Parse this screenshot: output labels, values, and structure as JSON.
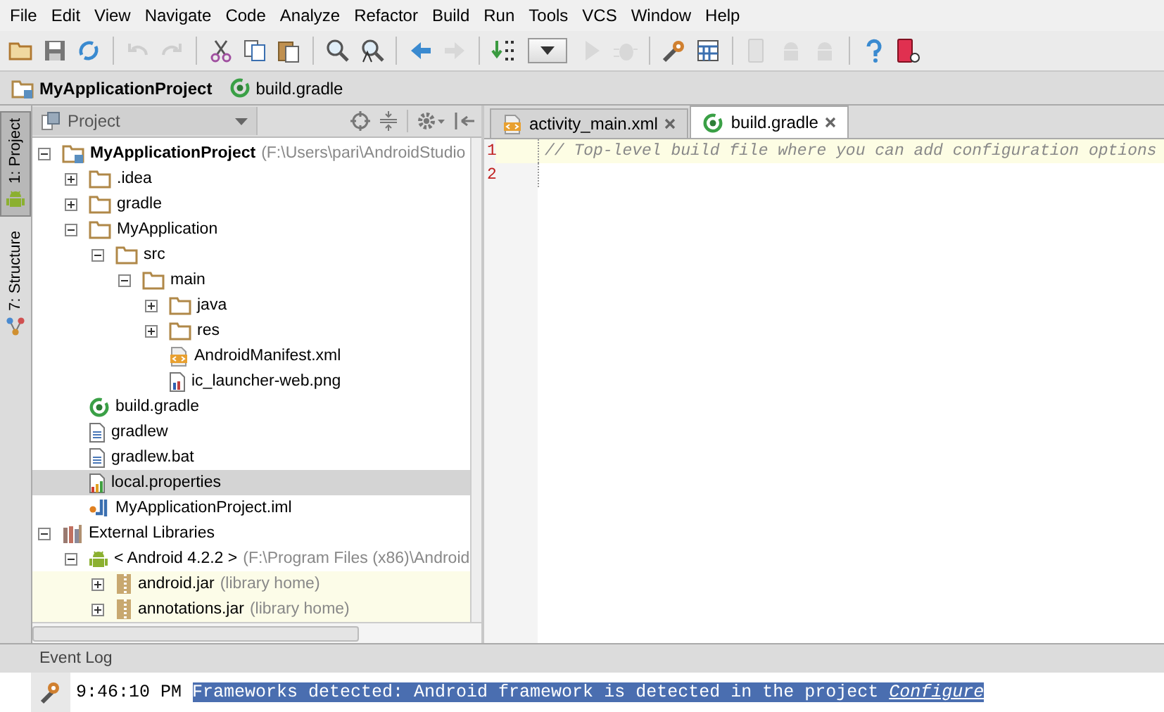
{
  "menu_bar": [
    "File",
    "Edit",
    "View",
    "Navigate",
    "Code",
    "Analyze",
    "Refactor",
    "Build",
    "Run",
    "Tools",
    "VCS",
    "Window",
    "Help"
  ],
  "toolbar": [
    {
      "kind": "open",
      "disabled": false
    },
    {
      "kind": "save",
      "disabled": false
    },
    {
      "kind": "sync",
      "disabled": false
    },
    {
      "kind": "sep"
    },
    {
      "kind": "undo",
      "disabled": true
    },
    {
      "kind": "redo",
      "disabled": true
    },
    {
      "kind": "sep"
    },
    {
      "kind": "cut",
      "disabled": false
    },
    {
      "kind": "copy",
      "disabled": false
    },
    {
      "kind": "paste",
      "disabled": false
    },
    {
      "kind": "sep"
    },
    {
      "kind": "find",
      "disabled": false
    },
    {
      "kind": "replace",
      "disabled": false
    },
    {
      "kind": "sep"
    },
    {
      "kind": "back",
      "disabled": false
    },
    {
      "kind": "forward",
      "disabled": true
    },
    {
      "kind": "sep"
    },
    {
      "kind": "make",
      "disabled": false
    },
    {
      "kind": "dropdown",
      "disabled": false
    },
    {
      "kind": "run",
      "disabled": true
    },
    {
      "kind": "debug",
      "disabled": true
    },
    {
      "kind": "sep"
    },
    {
      "kind": "settings",
      "disabled": false
    },
    {
      "kind": "structure",
      "disabled": false
    },
    {
      "kind": "sep"
    },
    {
      "kind": "device",
      "disabled": true
    },
    {
      "kind": "android",
      "disabled": true
    },
    {
      "kind": "android",
      "disabled": true
    },
    {
      "kind": "sep"
    },
    {
      "kind": "help",
      "disabled": false
    },
    {
      "kind": "monitor",
      "disabled": false
    }
  ],
  "breadcrumbs": [
    {
      "label": "MyApplicationProject",
      "kind": "project"
    },
    {
      "label": "build.gradle",
      "kind": "gradle"
    }
  ],
  "side_tabs": [
    {
      "label": "1: Project",
      "kind": "android",
      "selected": true
    },
    {
      "label": "7: Structure",
      "kind": "structure",
      "selected": false
    }
  ],
  "project_panel": {
    "view_selector": "Project",
    "tree": [
      {
        "label": "MyApplicationProject",
        "note": "(F:\\Users\\pari\\AndroidStudio",
        "kind": "project",
        "expanded": true,
        "selected": false,
        "children": [
          {
            "label": ".idea",
            "kind": "folder",
            "expanded": false,
            "selected": false
          },
          {
            "label": "gradle",
            "kind": "folder",
            "expanded": false,
            "selected": false
          },
          {
            "label": "MyApplication",
            "kind": "folder",
            "expanded": true,
            "selected": false,
            "children": [
              {
                "label": "src",
                "kind": "folder",
                "expanded": true,
                "selected": false,
                "children": [
                  {
                    "label": "main",
                    "kind": "folder",
                    "expanded": true,
                    "selected": false,
                    "children": [
                      {
                        "label": "java",
                        "kind": "folder",
                        "expanded": false,
                        "selected": false
                      },
                      {
                        "label": "res",
                        "kind": "folder",
                        "expanded": false,
                        "selected": false
                      },
                      {
                        "label": "AndroidManifest.xml",
                        "kind": "xml",
                        "selected": false
                      },
                      {
                        "label": "ic_launcher-web.png",
                        "kind": "image",
                        "selected": false
                      }
                    ]
                  }
                ]
              }
            ]
          },
          {
            "label": "build.gradle",
            "kind": "gradle",
            "selected": false
          },
          {
            "label": "gradlew",
            "kind": "file",
            "selected": false
          },
          {
            "label": "gradlew.bat",
            "kind": "file",
            "selected": false
          },
          {
            "label": "local.properties",
            "kind": "properties",
            "selected": true
          },
          {
            "label": "MyApplicationProject.iml",
            "kind": "iml",
            "selected": false
          }
        ]
      },
      {
        "label": "External Libraries",
        "kind": "libraries",
        "expanded": true,
        "selected": false,
        "children": [
          {
            "label": "< Android 4.2.2 >",
            "note": "(F:\\Program Files (x86)\\Android",
            "kind": "android",
            "expanded": true,
            "selected": false,
            "children": [
              {
                "label": "android.jar",
                "note": "(library home)",
                "kind": "jar",
                "expanded": false,
                "selected": false
              },
              {
                "label": "annotations.jar",
                "note": "(library home)",
                "kind": "jar",
                "expanded": false,
                "selected": false
              }
            ]
          }
        ]
      }
    ]
  },
  "editor": {
    "tabs": [
      {
        "label": "activity_main.xml",
        "kind": "xml",
        "selected": false
      },
      {
        "label": "build.gradle",
        "kind": "gradle",
        "selected": true
      }
    ],
    "lines": [
      {
        "number": "1",
        "text": "// Top-level build file where you can add configuration options",
        "current": true
      },
      {
        "number": "2",
        "current": false
      }
    ]
  },
  "event_log": {
    "title": "Event Log",
    "time": "9:46:10 PM",
    "message": "Frameworks detected: Android framework is detected in the project",
    "link": "Configure"
  }
}
